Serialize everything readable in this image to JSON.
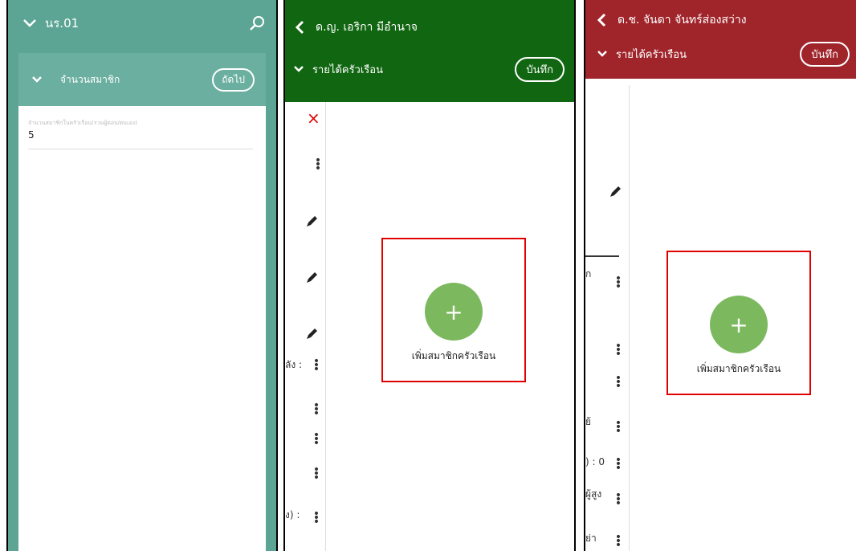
{
  "panel1": {
    "header_title": "นร.01",
    "section_title": "จำนวนสมาชิก",
    "next_button": "ถัดไป",
    "field_label": "จำนวนสมาชิกในครัวเรือน(รวมผู้ตอบ/ตนเอง)",
    "field_value": "5",
    "colors": {
      "header": "#6aaf9f",
      "panel_bg": "#5ca594"
    }
  },
  "panel2": {
    "header_title": "ด.ญ. เอริกา มีอำนาจ",
    "section_title": "รายได้ครัวเรือน",
    "save_button": "บันทึก",
    "fab_label": "เพิ่มสมาชิกครัวเรือน",
    "fab_symbol": "+",
    "close_symbol": "×",
    "clipped_texts": [
      "ลัง :",
      "ง) :"
    ],
    "colors": {
      "header": "#116611"
    }
  },
  "panel3": {
    "header_title": "ด.ช. จันดา จันทร์ส่องสว่าง",
    "section_title": "รายได้ครัวเรือน",
    "save_button": "บันทึก",
    "fab_label": "เพิ่มสมาชิกครัวเรือน",
    "fab_symbol": "+",
    "clipped_texts": [
      "ก",
      "ย้",
      ") : 0",
      "ผู้สูง",
      "ย่า"
    ],
    "colors": {
      "header": "#a0252b"
    }
  }
}
